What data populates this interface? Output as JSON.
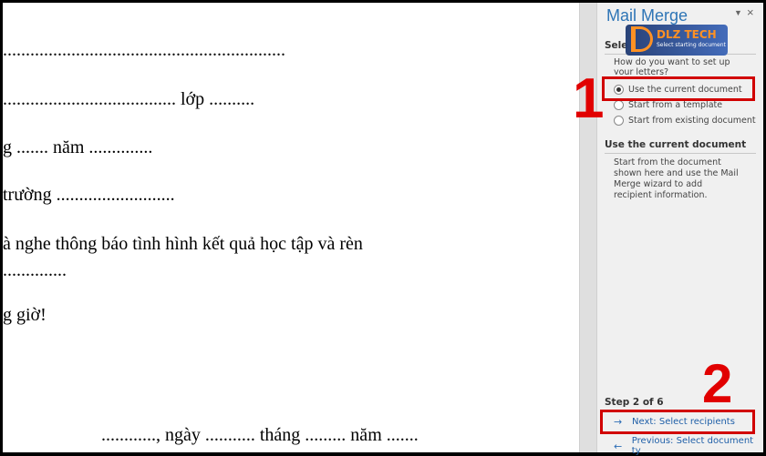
{
  "document": {
    "lines": [
      "..............................................................",
      "...................................... lớp ..........",
      "g ....... năm ..............",
      "trường ..........................",
      "à nghe thông báo tình hình kết quả học tập và rèn",
      "..............",
      "g giờ!",
      "............, ngày ........... tháng ......... năm ......."
    ]
  },
  "logo": {
    "text": "DLZ TECH",
    "subtext": "Select starting document"
  },
  "pane": {
    "title": "Mail Merge",
    "menu_glyph": "▼",
    "close_glyph": "×",
    "section_prefix": "Sele",
    "question": [
      "How do you want to set up",
      "your letters?"
    ],
    "options": [
      {
        "label": "Use the current document",
        "checked": true
      },
      {
        "label": "Start from a template",
        "checked": false
      },
      {
        "label": "Start from existing document",
        "checked": false
      }
    ],
    "desc_heading": "Use the current document",
    "desc_lines": [
      "Start from the document",
      "shown here and use the Mail",
      "Merge wizard to add",
      "recipient information."
    ],
    "step": "Step 2 of 6",
    "next_label": "Next: Select recipients",
    "prev_label": "Previous: Select document ty",
    "next_arrow": "→",
    "prev_arrow": "←"
  },
  "annotations": {
    "marker1": "1",
    "marker2": "2",
    "color": "#d10000"
  }
}
